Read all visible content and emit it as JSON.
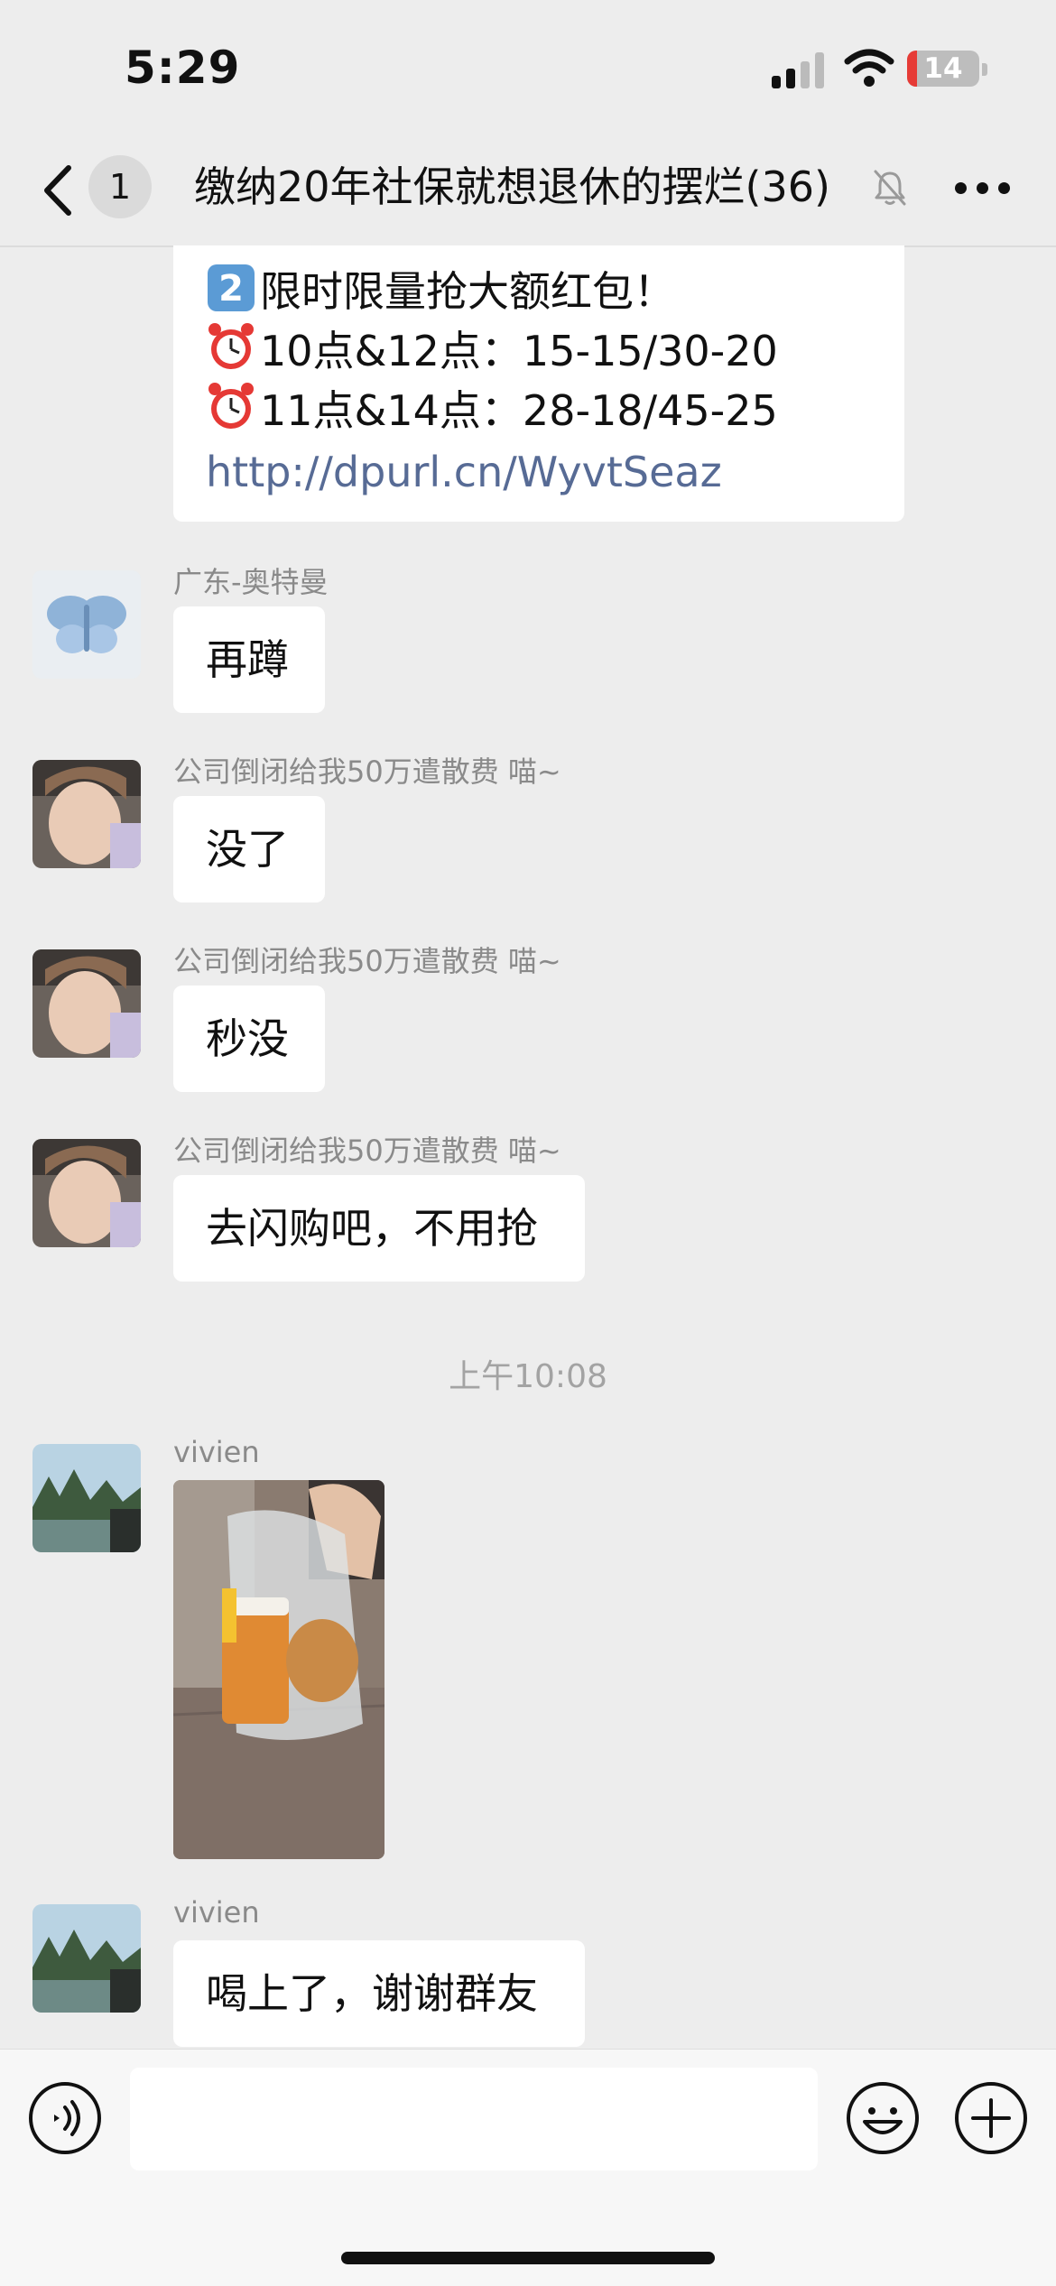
{
  "status_bar": {
    "time": "5:29",
    "battery_level": "14",
    "icons": [
      "cellular-signal-icon",
      "wifi-icon",
      "battery-icon"
    ]
  },
  "nav": {
    "back_icon": "chevron-left-icon",
    "unread_badge": "1",
    "title": "缴纳20年社保就想退休的摆烂",
    "member_count": "(36)",
    "mute_icon": "bell-muted-icon",
    "more_icon": "more-icon"
  },
  "promo_message": {
    "line1": "限时限量抢大额红包！",
    "line2": "10点&12点：15-15/30-20",
    "line3": "11点&14点：28-18/45-25",
    "link": "http://dpurl.cn/WyvtSeaz",
    "line1_icon": "keycap-2-icon",
    "line2_icon": "alarm-clock-icon",
    "line3_icon": "alarm-clock-icon"
  },
  "messages": [
    {
      "sender": "广东-奥特曼",
      "text": "再蹲",
      "avatar": "butterfly-avatar"
    },
    {
      "sender": "公司倒闭给我50万遣散费 喵~",
      "text": "没了",
      "avatar": "selfie-avatar"
    },
    {
      "sender": "公司倒闭给我50万遣散费 喵~",
      "text": "秒没",
      "avatar": "selfie-avatar"
    },
    {
      "sender": "公司倒闭给我50万遣散费 喵~",
      "text": "去闪购吧，不用抢",
      "avatar": "selfie-avatar"
    }
  ],
  "timestamp": "上午10:08",
  "vivien_messages": [
    {
      "sender": "vivien",
      "type": "image",
      "image": "photo-drink-in-plastic-bag",
      "avatar": "landscape-avatar"
    },
    {
      "sender": "vivien",
      "text": "喝上了，谢谢群友",
      "avatar": "landscape-avatar"
    }
  ],
  "input_bar": {
    "voice_icon": "voice-input-icon",
    "emoji_icon": "emoji-icon",
    "plus_icon": "add-icon",
    "input_value": ""
  },
  "colors": {
    "background": "#ededed",
    "bubble": "#ffffff",
    "link": "#576b95",
    "battery_low": "#e63b36"
  }
}
